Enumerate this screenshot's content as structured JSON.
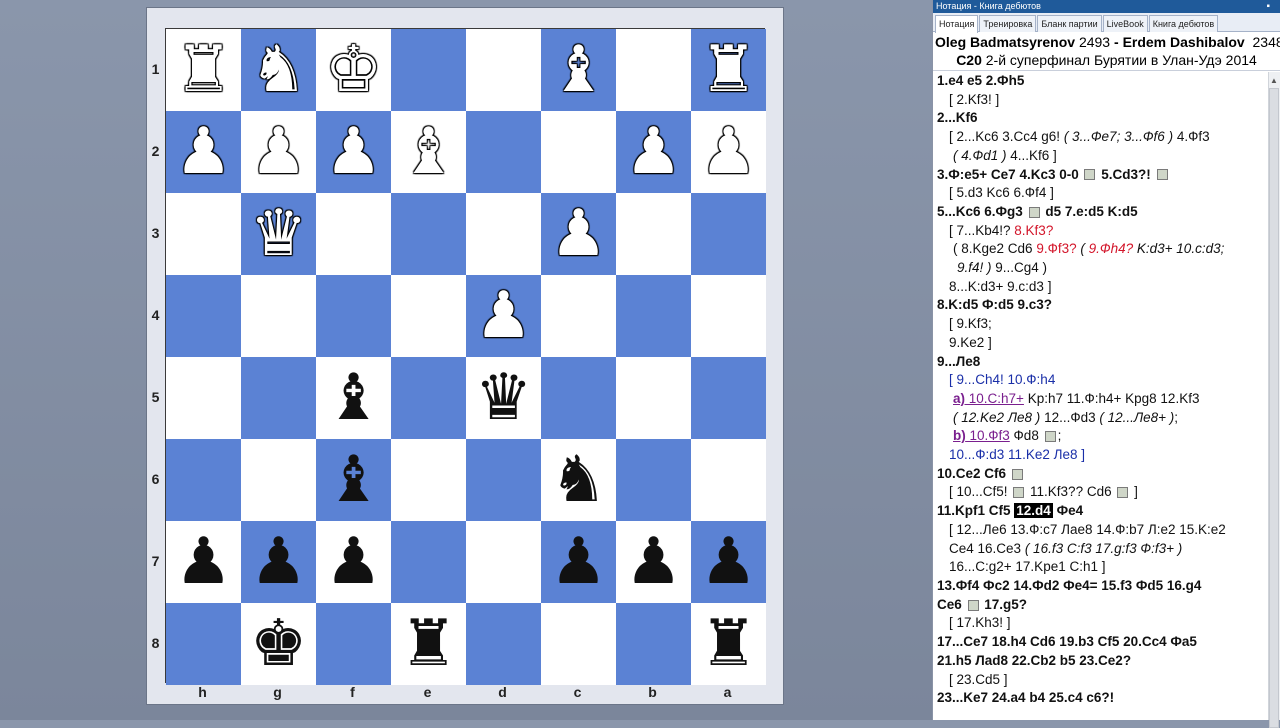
{
  "board": {
    "ranks": [
      "1",
      "2",
      "3",
      "4",
      "5",
      "6",
      "7",
      "8"
    ],
    "files": [
      "h",
      "g",
      "f",
      "e",
      "d",
      "c",
      "b",
      "a"
    ],
    "pieces": [
      {
        "sq": "h1",
        "glyph": "♜",
        "color": "w",
        "name": "white-rook-icon"
      },
      {
        "sq": "g1",
        "glyph": "♞",
        "color": "w",
        "name": "white-knight-icon"
      },
      {
        "sq": "f1",
        "glyph": "♚",
        "color": "w",
        "name": "white-king-icon"
      },
      {
        "sq": "c1",
        "glyph": "♝",
        "color": "w",
        "name": "white-bishop-icon"
      },
      {
        "sq": "a1",
        "glyph": "♜",
        "color": "w",
        "name": "white-rook-icon"
      },
      {
        "sq": "h2",
        "glyph": "♟",
        "color": "w",
        "name": "white-pawn-icon"
      },
      {
        "sq": "g2",
        "glyph": "♟",
        "color": "w",
        "name": "white-pawn-icon"
      },
      {
        "sq": "f2",
        "glyph": "♟",
        "color": "w",
        "name": "white-pawn-icon"
      },
      {
        "sq": "e2",
        "glyph": "♝",
        "color": "w",
        "name": "white-bishop-icon"
      },
      {
        "sq": "b2",
        "glyph": "♟",
        "color": "w",
        "name": "white-pawn-icon"
      },
      {
        "sq": "a2",
        "glyph": "♟",
        "color": "w",
        "name": "white-pawn-icon"
      },
      {
        "sq": "g3",
        "glyph": "♛",
        "color": "w",
        "name": "white-queen-icon"
      },
      {
        "sq": "c3",
        "glyph": "♟",
        "color": "w",
        "name": "white-pawn-icon"
      },
      {
        "sq": "d4",
        "glyph": "♟",
        "color": "w",
        "name": "white-pawn-icon"
      },
      {
        "sq": "f5",
        "glyph": "♝",
        "color": "b",
        "name": "black-bishop-icon"
      },
      {
        "sq": "d5",
        "glyph": "♛",
        "color": "b",
        "name": "black-queen-icon"
      },
      {
        "sq": "f6",
        "glyph": "♝",
        "color": "b",
        "name": "black-bishop-icon"
      },
      {
        "sq": "c6",
        "glyph": "♞",
        "color": "b",
        "name": "black-knight-icon"
      },
      {
        "sq": "h7",
        "glyph": "♟",
        "color": "b",
        "name": "black-pawn-icon"
      },
      {
        "sq": "g7",
        "glyph": "♟",
        "color": "b",
        "name": "black-pawn-icon"
      },
      {
        "sq": "f7",
        "glyph": "♟",
        "color": "b",
        "name": "black-pawn-icon"
      },
      {
        "sq": "c7",
        "glyph": "♟",
        "color": "b",
        "name": "black-pawn-icon"
      },
      {
        "sq": "b7",
        "glyph": "♟",
        "color": "b",
        "name": "black-pawn-icon"
      },
      {
        "sq": "a7",
        "glyph": "♟",
        "color": "b",
        "name": "black-pawn-icon"
      },
      {
        "sq": "g8",
        "glyph": "♚",
        "color": "b",
        "name": "black-king-icon"
      },
      {
        "sq": "e8",
        "glyph": "♜",
        "color": "b",
        "name": "black-rook-icon"
      },
      {
        "sq": "a8",
        "glyph": "♜",
        "color": "b",
        "name": "black-rook-icon"
      }
    ],
    "colors": {
      "light": "#ffffff",
      "dark": "#5b82d4"
    }
  },
  "panel": {
    "title": "Нотация - Книга дебютов",
    "tabs": [
      "Нотация",
      "Тренировка",
      "Бланк партии",
      "LiveBook",
      "Книга дебютов"
    ],
    "active_tab": 0,
    "white_player": "Oleg Badmatsyrenov",
    "white_elo": "2493",
    "separator": "-",
    "black_player": "Erdem Dashibalov",
    "black_elo": "2348",
    "eco": "C20",
    "event": "2-й суперфинал Бурятии в Улан-Удэ 2014"
  },
  "notation": [
    {
      "cls": "main",
      "html": "1.e4  e5  2.Фh5"
    },
    {
      "cls": "i1",
      "html": "[ 2.Kf3! ]"
    },
    {
      "cls": "main",
      "html": "2...Kf6"
    },
    {
      "cls": "i1",
      "html": "[ 2...Kc6  3.Cc4  g6! <span class='it'>( 3...Фe7; 3...Фf6 )</span> 4.Фf3"
    },
    {
      "cls": "i2",
      "html": "<span class='it'>( 4.Фd1 )</span> 4...Kf6 ]"
    },
    {
      "cls": "main",
      "html": "3.Ф:e5+  Ce7  4.Kc3  0-0 <span class='diag'></span> 5.Cd3?! <span class='diag'></span>"
    },
    {
      "cls": "i1",
      "html": "[ 5.d3  Kc6  6.Фf4 ]"
    },
    {
      "cls": "main",
      "html": "5...Kc6  6.Фg3 <span class='diag'></span> d5  7.e:d5  K:d5"
    },
    {
      "cls": "i1",
      "html": "[ 7...Kb4!? <span class='red'>8.Kf3?</span>"
    },
    {
      "cls": "i2",
      "html": "( 8.Kge2  Cd6 <span class='red'>9.Фf3?</span> <span class='it'>( <span class='red'>9.Фh4?</span> K:d3+  10.c:d3;</span>"
    },
    {
      "cls": "i3",
      "html": "<span class='it'>9.f4! )</span> 9...Cg4 )"
    },
    {
      "cls": "i1",
      "html": "8...K:d3+  9.c:d3 ]"
    },
    {
      "cls": "main",
      "html": "8.K:d5  Ф:d5  9.c3?"
    },
    {
      "cls": "i1",
      "html": "[ 9.Kf3;"
    },
    {
      "cls": "i1",
      "html": "9.Ke2 ]"
    },
    {
      "cls": "main",
      "html": "9...Лe8"
    },
    {
      "cls": "i1 blue",
      "html": "[ 9...Ch4!  10.Ф:h4"
    },
    {
      "cls": "i2",
      "html": "<span class='purple'><b>a)</b> 10.C:h7+</span>  Kp:h7  11.Ф:h4+  Kpg8  12.Kf3"
    },
    {
      "cls": "i2",
      "html": "<span class='it'>( 12.Ke2  Лe8 )</span> 12...Фd3  <span class='it'>( 12...Лe8+ )</span>;"
    },
    {
      "cls": "i2",
      "html": "<span class='purple'><b>b)</b> 10.Фf3</span>  Фd8 <span class='diag'></span>;"
    },
    {
      "cls": "i1 blue",
      "html": "10...Ф:d3  11.Ke2  Лe8 ]"
    },
    {
      "cls": "main",
      "html": "10.Ce2  Cf6 <span class='diag'></span>"
    },
    {
      "cls": "i1",
      "html": "[ 10...Cf5! <span class='diag'></span> 11.Kf3??  Cd6 <span class='diag'></span> ]"
    },
    {
      "cls": "main",
      "html": "11.Kpf1  Cf5 <span class='cur'>12.d4</span> Фe4"
    },
    {
      "cls": "i1",
      "html": "[ 12...Лe6  13.Ф:c7  Лae8  14.Ф:b7  Л:e2  15.K:e2"
    },
    {
      "cls": "i1",
      "html": "Ce4  16.Ce3  <span class='it'>( 16.f3  C:f3  17.g:f3  Ф:f3+ )</span>"
    },
    {
      "cls": "i1",
      "html": "16...C:g2+  17.Kpe1  C:h1 ]"
    },
    {
      "cls": "main",
      "html": "13.Фf4  Фc2  14.Фd2  Фe4=  15.f3  Фd5  16.g4"
    },
    {
      "cls": "main",
      "html": "Ce6 <span class='diag'></span> 17.g5?"
    },
    {
      "cls": "i1",
      "html": "[ 17.Kh3! ]"
    },
    {
      "cls": "main",
      "html": "17...Ce7  18.h4  Cd6  19.b3  Cf5  20.Cc4  Фa5"
    },
    {
      "cls": "main",
      "html": "21.h5  Лad8  22.Cb2  b5  23.Ce2?"
    },
    {
      "cls": "i1",
      "html": "[ 23.Cd5 ]"
    },
    {
      "cls": "main",
      "html": "23...Ke7  24.a4  b4  25.c4  c6?!"
    }
  ]
}
